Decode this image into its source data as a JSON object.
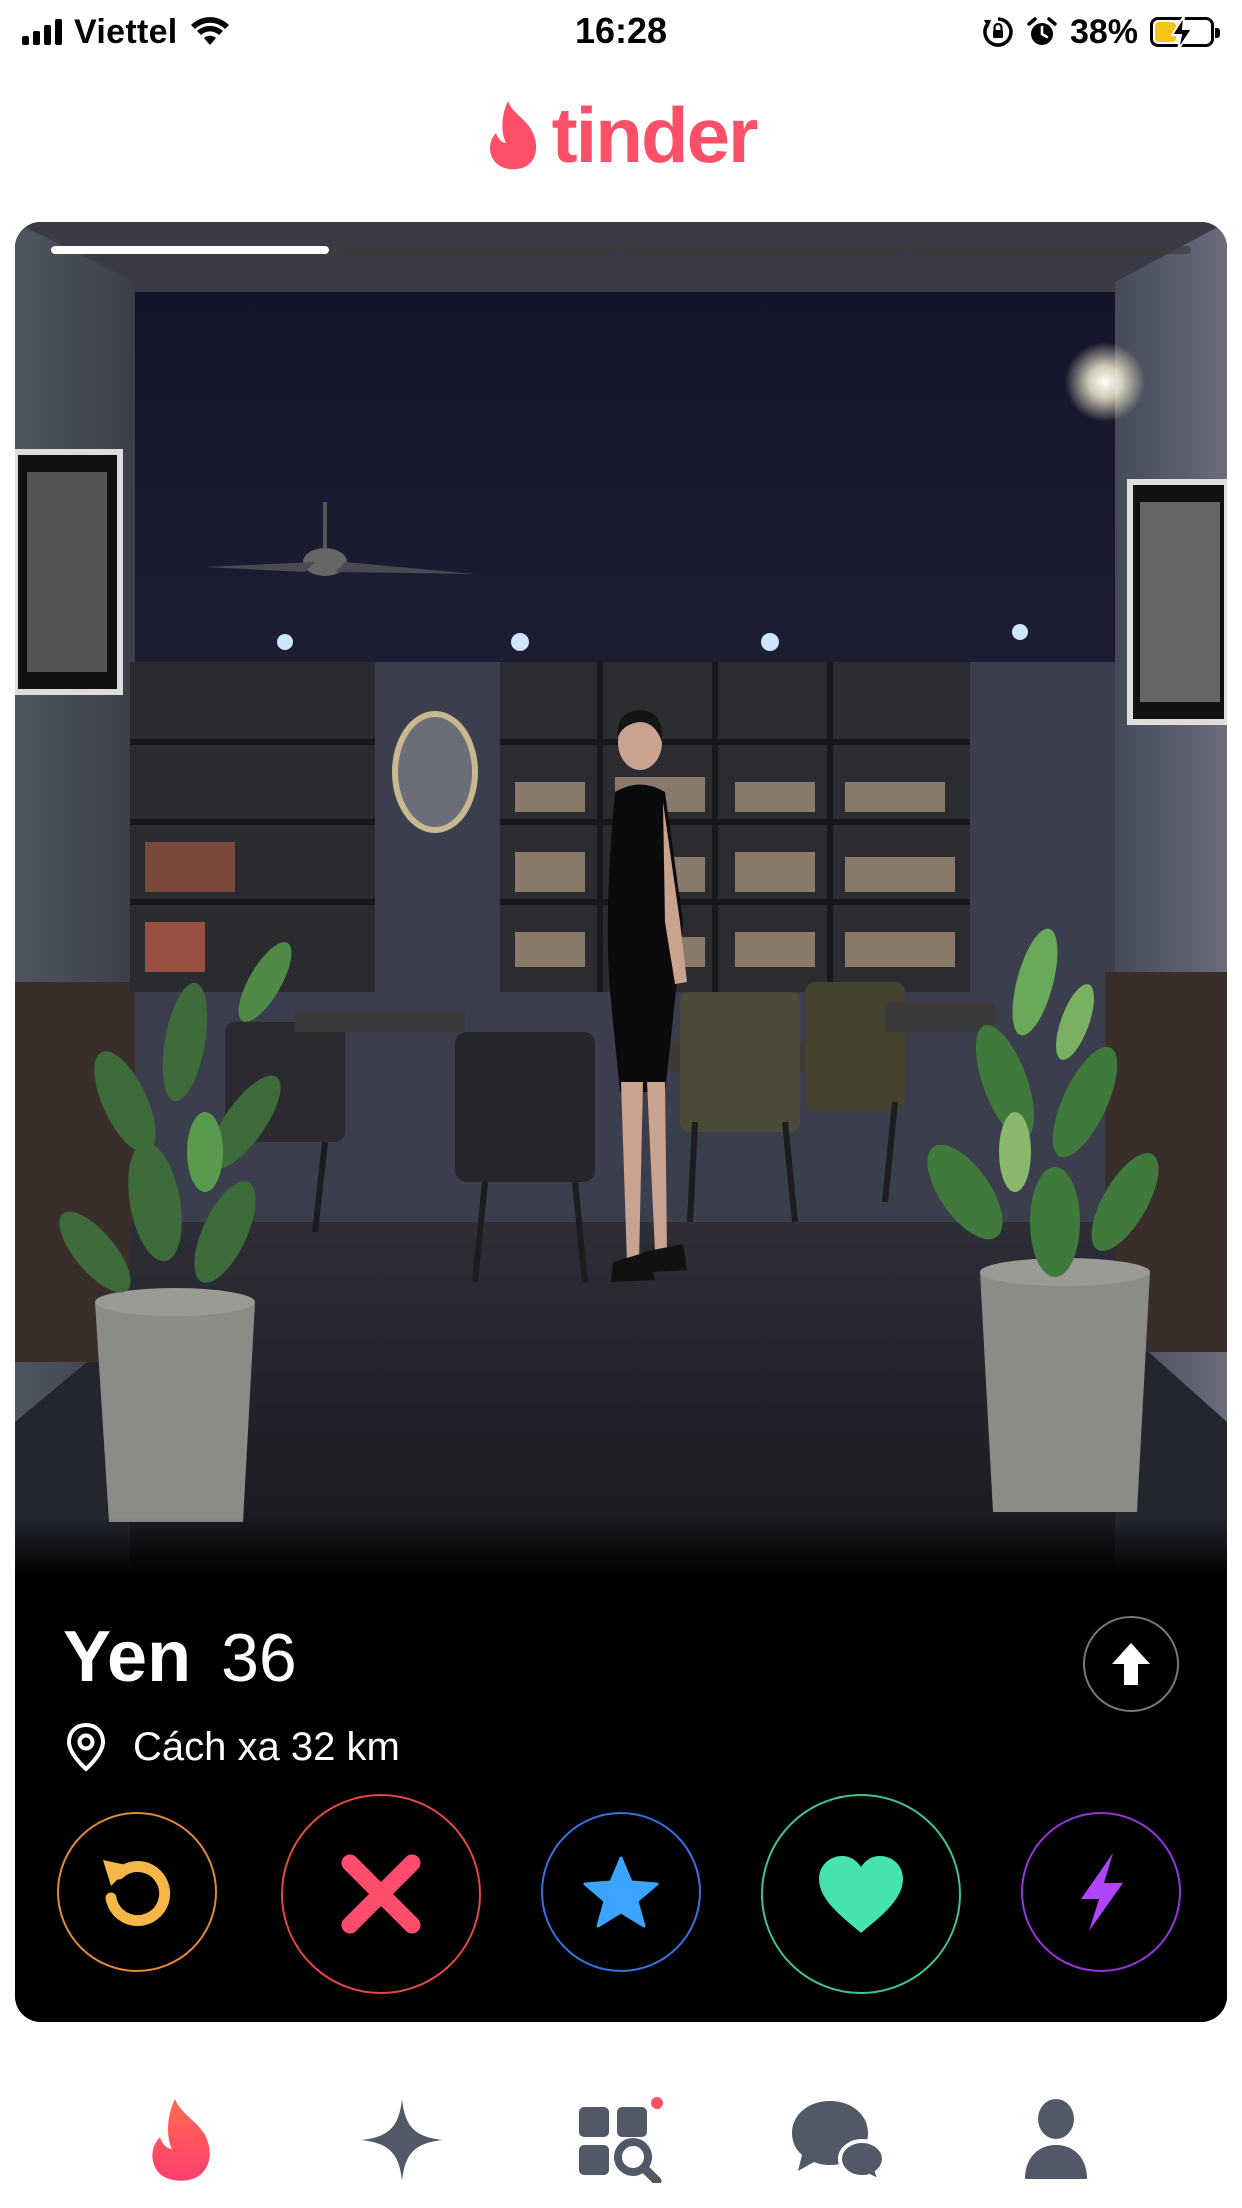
{
  "status_bar": {
    "carrier": "Viettel",
    "time": "16:28",
    "battery_percent": "38%",
    "battery_level": 0.38,
    "icons": [
      "signal-icon",
      "wifi-icon",
      "orientation-lock-icon",
      "alarm-icon",
      "battery-charging-icon"
    ]
  },
  "header": {
    "logo_text": "tinder",
    "logo_icon": "flame-icon"
  },
  "colors": {
    "brand": "#fd5068",
    "rewind": "#f5b748",
    "nope": "#fe4d6c",
    "super_like": "#3ca4ff",
    "like": "#44e3b0",
    "boost": "#b045ff",
    "nav_active": "#fd5068",
    "nav_inactive": "#505965"
  },
  "card": {
    "photo_count": 4,
    "current_photo": 1,
    "name": "Yen",
    "age": "36",
    "distance": "Cách xa 32 km",
    "icons": [
      "location-pin-icon",
      "arrow-up-icon"
    ]
  },
  "actions": [
    {
      "name": "rewind",
      "icon": "rewind-icon"
    },
    {
      "name": "nope",
      "icon": "close-icon"
    },
    {
      "name": "super-like",
      "icon": "star-icon"
    },
    {
      "name": "like",
      "icon": "heart-icon"
    },
    {
      "name": "boost",
      "icon": "lightning-icon"
    }
  ],
  "bottom_nav": {
    "items": [
      {
        "name": "home",
        "icon": "flame-icon",
        "active": true
      },
      {
        "name": "explore",
        "icon": "sparkle-icon",
        "active": false
      },
      {
        "name": "top-picks",
        "icon": "grid-search-icon",
        "active": false,
        "dot": true
      },
      {
        "name": "messages",
        "icon": "chat-bubbles-icon",
        "active": false
      },
      {
        "name": "profile",
        "icon": "person-icon",
        "active": false
      }
    ]
  }
}
